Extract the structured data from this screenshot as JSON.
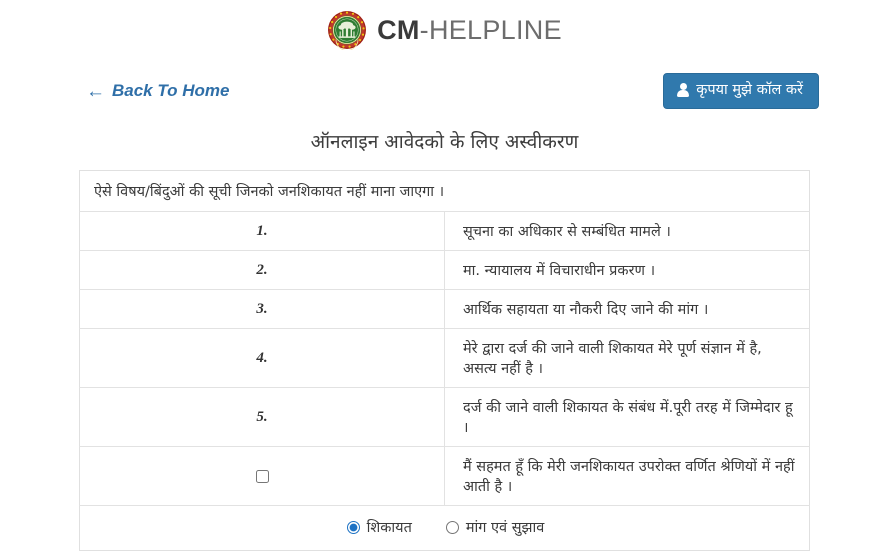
{
  "brand": {
    "emblem_icon": "mp-state-emblem-icon",
    "name_bold": "CM",
    "name_dash": "-",
    "name_rest": "HELPLINE"
  },
  "nav": {
    "back_arrow": "←",
    "back_label": "Back To Home",
    "call_icon": "user-icon",
    "call_label": "कृपया मुझे कॉल करें"
  },
  "page": {
    "title": "ऑनलाइन आवेदको के लिए अस्वीकरण"
  },
  "table": {
    "header": "ऐसे विषय/बिंदुओं की सूची जिनको जनशिकायत नहीं माना जाएगा ।",
    "rows": [
      {
        "num": "1.",
        "text": "सूचना का अधिकार से सम्बंधित मामले ।"
      },
      {
        "num": "2.",
        "text": "मा. न्यायालय में विचाराधीन प्रकरण ।"
      },
      {
        "num": "3.",
        "text": "आर्थिक सहायता या नौकरी दिए जाने की मांग ।"
      },
      {
        "num": "4.",
        "text": "मेरे द्वारा दर्ज की जाने वाली शिकायत मेरे पूर्ण संज्ञान में है, असत्य नहीं है ।"
      },
      {
        "num": "5.",
        "text": "दर्ज की जाने वाली शिकायत के संबंध में.पूरी तरह में जिम्मेदार हू ।"
      }
    ],
    "agree": {
      "checked": false,
      "label": "मैं सहमत हूँ कि मेरी जनशिकायत उपरोक्त वर्णित श्रेणियों में नहीं आती है ।"
    },
    "type_options": [
      {
        "label": "शिकायत",
        "selected": true
      },
      {
        "label": "मांग एवं सुझाव",
        "selected": false
      }
    ]
  },
  "colors": {
    "primary_blue": "#3079ad",
    "link_blue": "#2f6fa8",
    "radio_accent": "#1d72c4",
    "border_gray": "#e2e2e2",
    "emblem_red": "#c0392b",
    "emblem_green": "#2f7d32"
  }
}
